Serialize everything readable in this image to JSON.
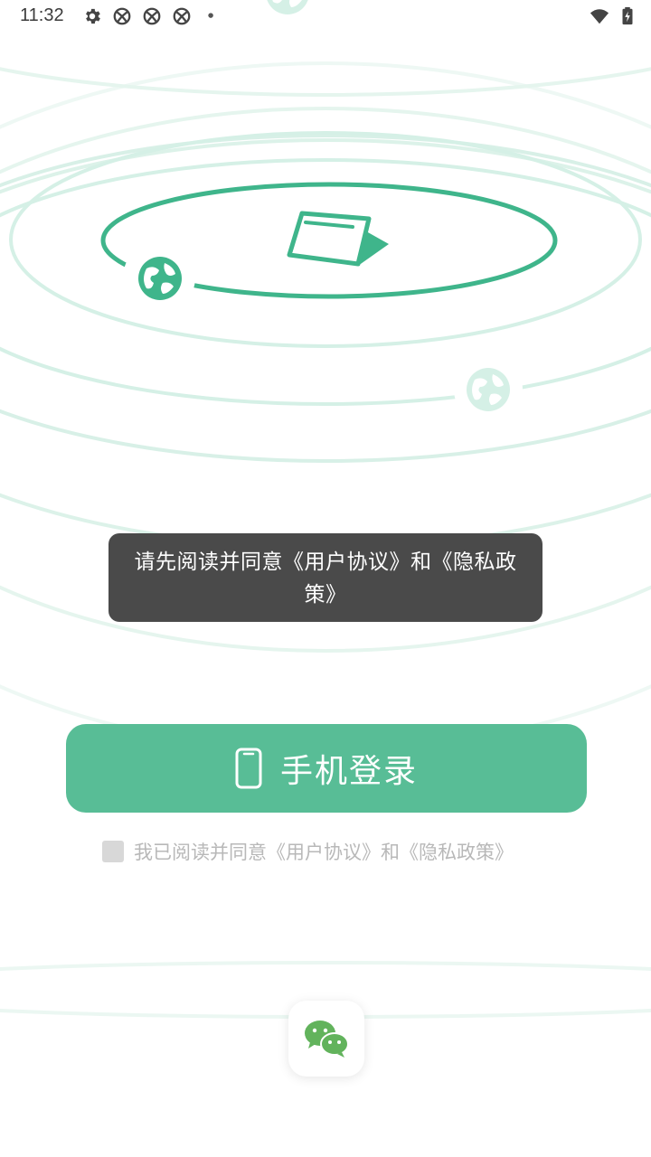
{
  "status_bar": {
    "time": "11:32",
    "icons": [
      "settings-icon",
      "app-notification-icon",
      "app-notification-icon",
      "app-notification-icon",
      "more-dot-icon",
      "wifi-icon",
      "battery-charging-icon"
    ]
  },
  "illustration": {
    "icons": [
      "globe-icon",
      "globe-icon",
      "globe-icon",
      "ticket-icon"
    ]
  },
  "toast": {
    "message": "请先阅读并同意《用户协议》和《隐私政策》"
  },
  "login": {
    "button_label": "手机登录",
    "icon": "phone-icon"
  },
  "agreement": {
    "prefix": "我已阅读并同意",
    "user_agreement": "《用户协议》",
    "conjunction": "和",
    "privacy_policy": "《隐私政策》",
    "checked": false
  },
  "third_party": {
    "wechat_icon": "wechat-icon"
  },
  "colors": {
    "primary": "#58bd96",
    "orbit_dark": "#3fb58b",
    "orbit_light": "#d5f0e6",
    "toast_bg": "#4a4a4a"
  }
}
